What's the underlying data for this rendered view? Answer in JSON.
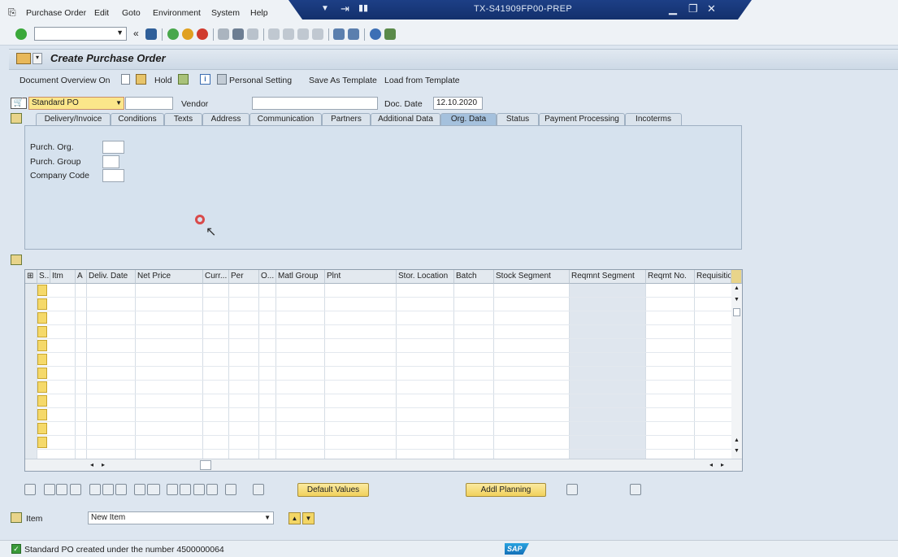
{
  "window": {
    "title": "TX-S41909FP00-PREP"
  },
  "menu": [
    "Purchase Order",
    "Edit",
    "Goto",
    "Environment",
    "System",
    "Help"
  ],
  "page": {
    "title": "Create Purchase Order"
  },
  "app_toolbar": {
    "doc_overview": "Document Overview On",
    "hold": "Hold",
    "personal_setting": "Personal Setting",
    "save_as_template": "Save As Template",
    "load_from_template": "Load from Template"
  },
  "header": {
    "doc_type": "Standard PO",
    "vendor_label": "Vendor",
    "vendor_value": "",
    "doc_date_label": "Doc. Date",
    "doc_date_value": "12.10.2020"
  },
  "tabs": [
    "Delivery/Invoice",
    "Conditions",
    "Texts",
    "Address",
    "Communication",
    "Partners",
    "Additional Data",
    "Org. Data",
    "Status",
    "Payment Processing",
    "Incoterms"
  ],
  "active_tab": "Org. Data",
  "org_data": {
    "purch_org_label": "Purch. Org.",
    "purch_group_label": "Purch. Group",
    "company_code_label": "Company Code"
  },
  "grid": {
    "columns": [
      "S..",
      "Itm",
      "A",
      "Deliv. Date",
      "Net Price",
      "Curr...",
      "Per",
      "O...",
      "Matl Group",
      "Plnt",
      "Stor. Location",
      "Batch",
      "Stock Segment",
      "Reqmnt Segment",
      "Reqmt No.",
      "Requisitio"
    ]
  },
  "buttons": {
    "default_values": "Default Values",
    "addl_planning": "Addl Planning"
  },
  "item": {
    "label": "Item",
    "value": "New Item"
  },
  "status": {
    "message": "Standard PO created under the number 4500000064",
    "logo": "SAP"
  },
  "colors": {
    "accent": "#1d3f86",
    "panel": "#d6e2ee",
    "button": "#f1d15c"
  }
}
